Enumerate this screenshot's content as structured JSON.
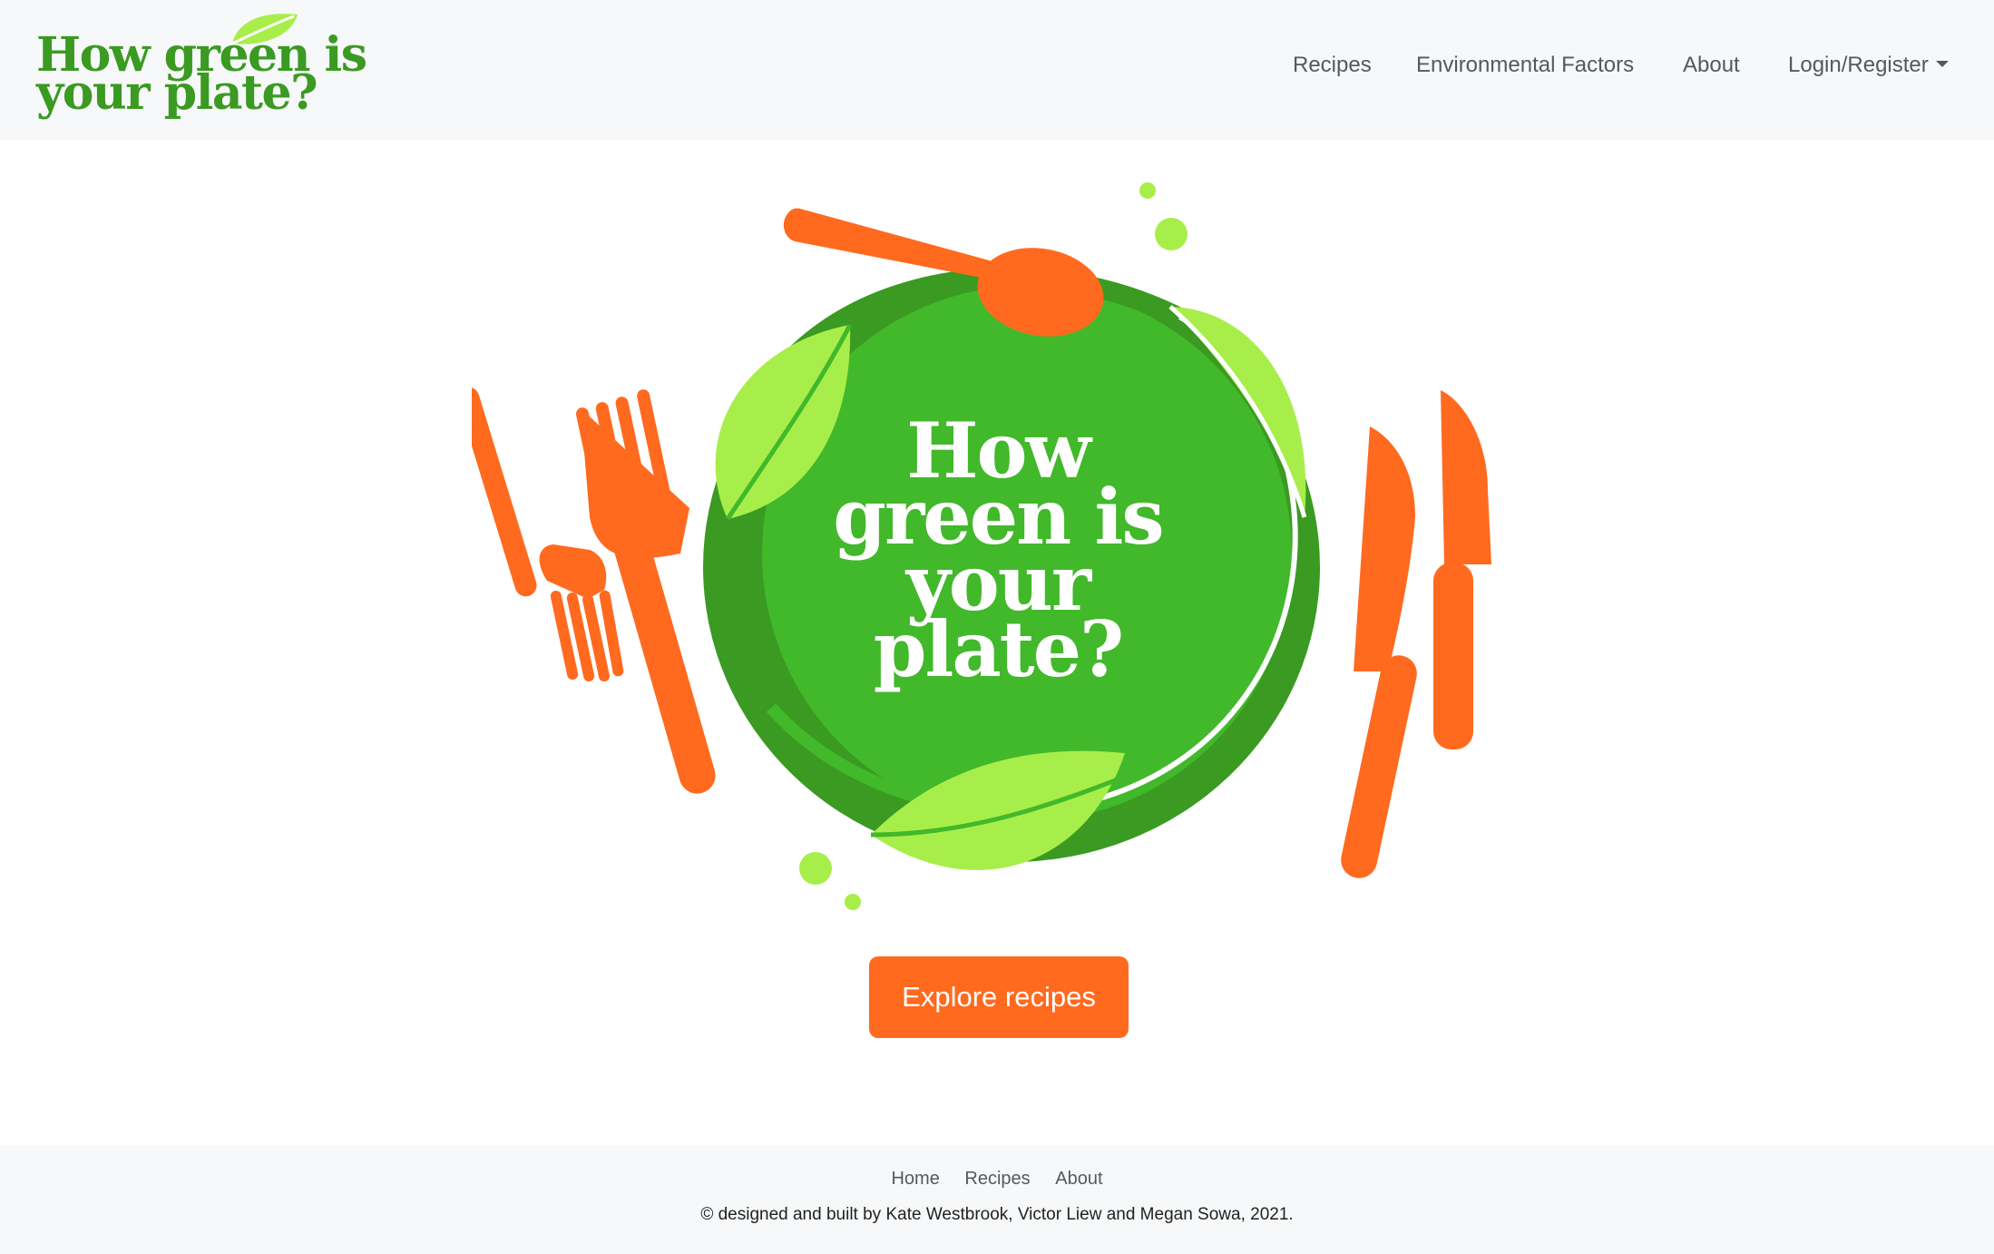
{
  "brand": {
    "line1": "How green is",
    "line2": "your plate?",
    "color": "#3a9a22",
    "leaf_color": "#a8ee4a"
  },
  "nav": {
    "recipes": "Recipes",
    "environmental": "Environmental Factors",
    "about": "About",
    "login": "Login/Register"
  },
  "hero": {
    "line1": "How",
    "line2": "green is",
    "line3": "your",
    "line4": "plate?",
    "colors": {
      "plate_dark": "#3a9a22",
      "plate_light": "#42b82b",
      "leaf": "#a8ee4a",
      "cutlery": "#ff6a1f"
    },
    "icons": [
      "fork-icon",
      "knife-icon",
      "spoon-icon",
      "leaf-icon",
      "plate-icon"
    ]
  },
  "cta": {
    "label": "Explore recipes",
    "color": "#ff6a1f"
  },
  "footer": {
    "home": "Home",
    "recipes": "Recipes",
    "about": "About",
    "copyright": "© designed and built by Kate Westbrook, Victor Liew and Megan Sowa, 2021."
  }
}
